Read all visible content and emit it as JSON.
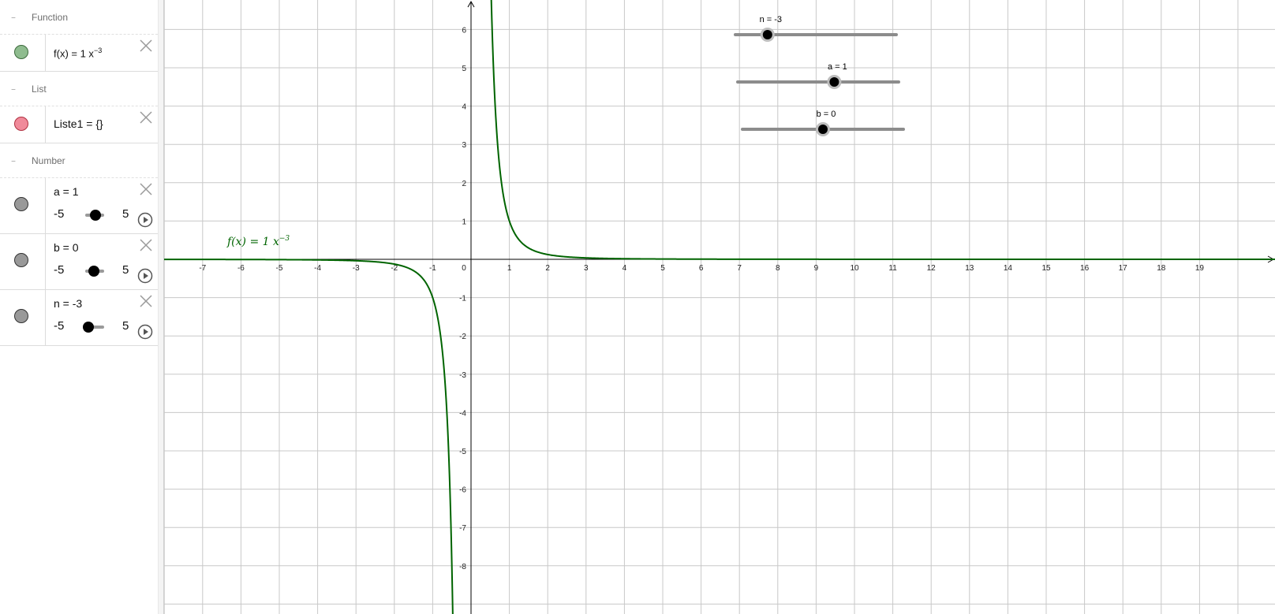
{
  "algebra": {
    "groups": {
      "function": {
        "title": "Function"
      },
      "list": {
        "title": "List"
      },
      "number": {
        "title": "Number"
      }
    },
    "function_row": {
      "expr_prefix": "f(x) = 1 x",
      "expr_exponent": "−3",
      "marble_color": "#8fbc8f"
    },
    "list_row": {
      "expr": "Liste1 = {}",
      "marble_color": "#f08a9a"
    },
    "number_rows": [
      {
        "label": "a = 1",
        "min": "-5",
        "max": "5",
        "value": 1,
        "range": [
          -5,
          5
        ]
      },
      {
        "label": "b = 0",
        "min": "-5",
        "max": "5",
        "value": 0,
        "range": [
          -5,
          5
        ]
      },
      {
        "label": "n = -3",
        "min": "-5",
        "max": "5",
        "value": -3,
        "range": [
          -5,
          5
        ]
      }
    ],
    "number_marble_color": "#999999"
  },
  "graphics": {
    "curve_label": {
      "main": "f(x)  =  1 x",
      "exponent": "−3"
    },
    "curve_color": "#006400",
    "grid_color": "#c8c8c8",
    "sliders": [
      {
        "name": "n",
        "label": "n = -3",
        "value": -3,
        "range": [
          -5,
          5
        ]
      },
      {
        "name": "a",
        "label": "a = 1",
        "value": 1,
        "range": [
          -5,
          5
        ]
      },
      {
        "name": "b",
        "label": "b = 0",
        "value": 0,
        "range": [
          -5,
          5
        ]
      }
    ]
  },
  "chart_data": {
    "type": "line",
    "x_range": [
      -8,
      20
    ],
    "y_range": [
      -8.8,
      6.8
    ],
    "x_ticks": [
      "-7",
      "-6",
      "-5",
      "-4",
      "-3",
      "-2",
      "-1",
      "0",
      "1",
      "2",
      "3",
      "4",
      "5",
      "6",
      "7",
      "8",
      "9",
      "10",
      "11",
      "12",
      "13",
      "14",
      "15",
      "16",
      "17",
      "18",
      "19"
    ],
    "y_ticks": [
      "6",
      "5",
      "4",
      "3",
      "2",
      "1",
      "-1",
      "-2",
      "-3",
      "-4",
      "-5",
      "-6",
      "-7",
      "-8"
    ],
    "grid": true,
    "series": [
      {
        "name": "f(x) = 1 x^-3",
        "function": "x^-3"
      }
    ]
  }
}
